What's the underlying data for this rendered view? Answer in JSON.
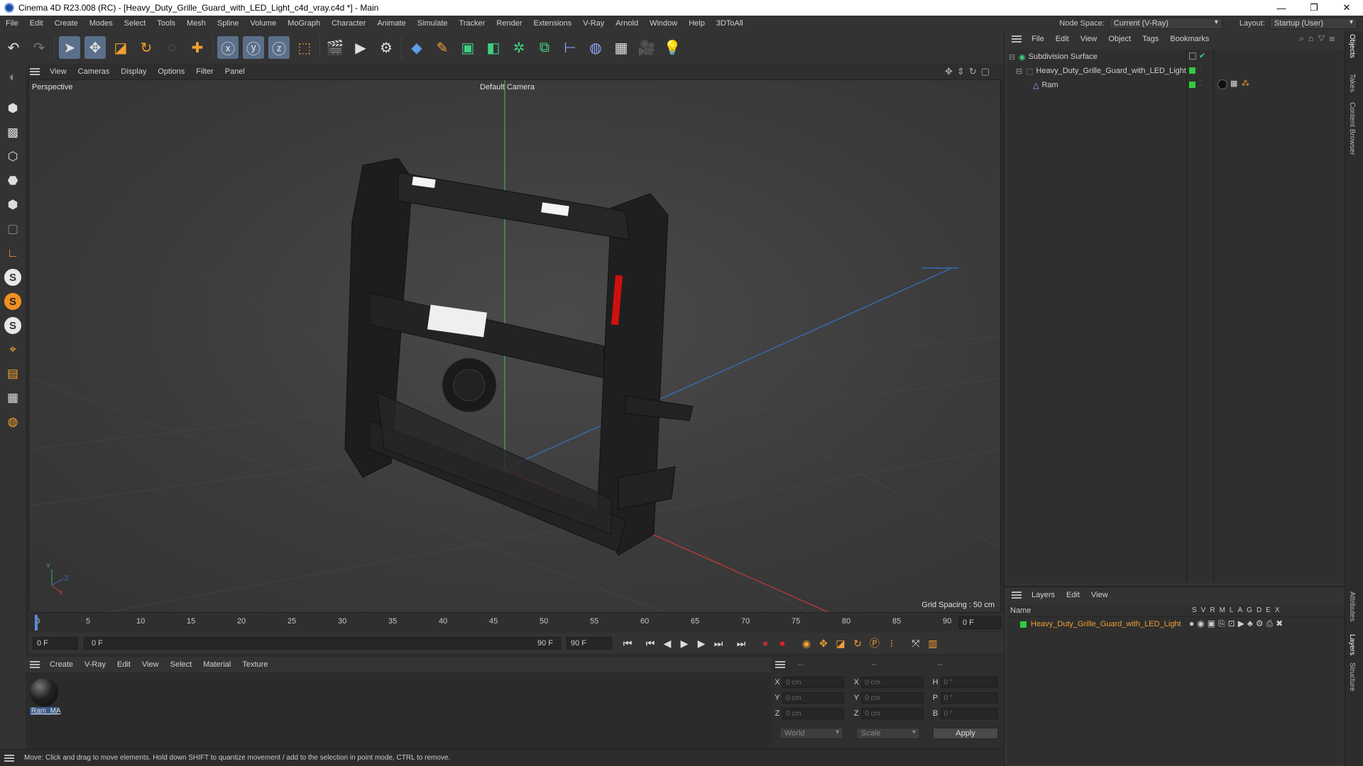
{
  "window": {
    "title": "Cinema 4D R23.008 (RC) - [Heavy_Duty_Grille_Guard_with_LED_Light_c4d_vray.c4d *] - Main",
    "controls": [
      "—",
      "❐",
      "✕"
    ]
  },
  "menubar": {
    "items": [
      "File",
      "Edit",
      "Create",
      "Modes",
      "Select",
      "Tools",
      "Mesh",
      "Spline",
      "Volume",
      "MoGraph",
      "Character",
      "Animate",
      "Simulate",
      "Tracker",
      "Render",
      "Extensions",
      "V-Ray",
      "Arnold",
      "Window",
      "Help",
      "3DToAll"
    ],
    "node_space_label": "Node Space:",
    "node_space_value": "Current (V-Ray)",
    "layout_label": "Layout:",
    "layout_value": "Startup (User)"
  },
  "viewport": {
    "menu": [
      "View",
      "Cameras",
      "Display",
      "Options",
      "Filter",
      "Panel"
    ],
    "view_name": "Perspective",
    "camera": "Default Camera",
    "grid_spacing": "Grid Spacing : 50 cm",
    "axis_y": "Y",
    "axis_z": "Z",
    "axis_x": "X",
    "colors": {
      "grid_green": "#3fae5a",
      "grid_blue": "#3a6fc8",
      "grid_red": "#c83a3a"
    }
  },
  "timeline": {
    "ticks": [
      "0",
      "5",
      "10",
      "15",
      "20",
      "25",
      "30",
      "35",
      "40",
      "45",
      "50",
      "55",
      "60",
      "65",
      "70",
      "75",
      "80",
      "85",
      "90"
    ],
    "end_field": "0 F",
    "start_frame": "0 F",
    "range_start": "0 F",
    "range_end": "90 F",
    "max_frame": "90 F"
  },
  "material_manager": {
    "menu": [
      "Create",
      "V-Ray",
      "Edit",
      "View",
      "Select",
      "Material",
      "Texture"
    ],
    "materials": [
      {
        "name": "Ram_MA"
      }
    ]
  },
  "attributes": {
    "headers": [
      "--",
      "--",
      "--"
    ],
    "rows": [
      {
        "a": "X",
        "av": "0 cm",
        "b": "X",
        "bv": "0 cm",
        "c": "H",
        "cv": "0 °"
      },
      {
        "a": "Y",
        "av": "0 cm",
        "b": "Y",
        "bv": "0 cm",
        "c": "P",
        "cv": "0 °"
      },
      {
        "a": "Z",
        "av": "0 cm",
        "b": "Z",
        "bv": "0 cm",
        "c": "B",
        "cv": "0 °"
      }
    ],
    "world": "World",
    "scale": "Scale",
    "apply": "Apply"
  },
  "status": {
    "text": "Move: Click and drag to move elements. Hold down SHIFT to quantize movement / add to the selection in point mode, CTRL to remove."
  },
  "object_manager": {
    "menu": [
      "File",
      "Edit",
      "View",
      "Object",
      "Tags",
      "Bookmarks"
    ],
    "objects": [
      {
        "name": "Subdivision Surface",
        "indent": 0
      },
      {
        "name": "Heavy_Duty_Grille_Guard_with_LED_Light",
        "indent": 1
      },
      {
        "name": "Ram",
        "indent": 2
      }
    ]
  },
  "layers": {
    "menu": [
      "Layers",
      "Edit",
      "View"
    ],
    "name_header": "Name",
    "columns": [
      "S",
      "V",
      "R",
      "M",
      "L",
      "A",
      "G",
      "D",
      "E",
      "X"
    ],
    "items": [
      {
        "name": "Heavy_Duty_Grille_Guard_with_LED_Light",
        "color": "#2ecc40"
      }
    ]
  },
  "right_tabs": [
    "Objects",
    "Takes",
    "Content Browser",
    "Attributes",
    "Layers",
    "Structure"
  ]
}
